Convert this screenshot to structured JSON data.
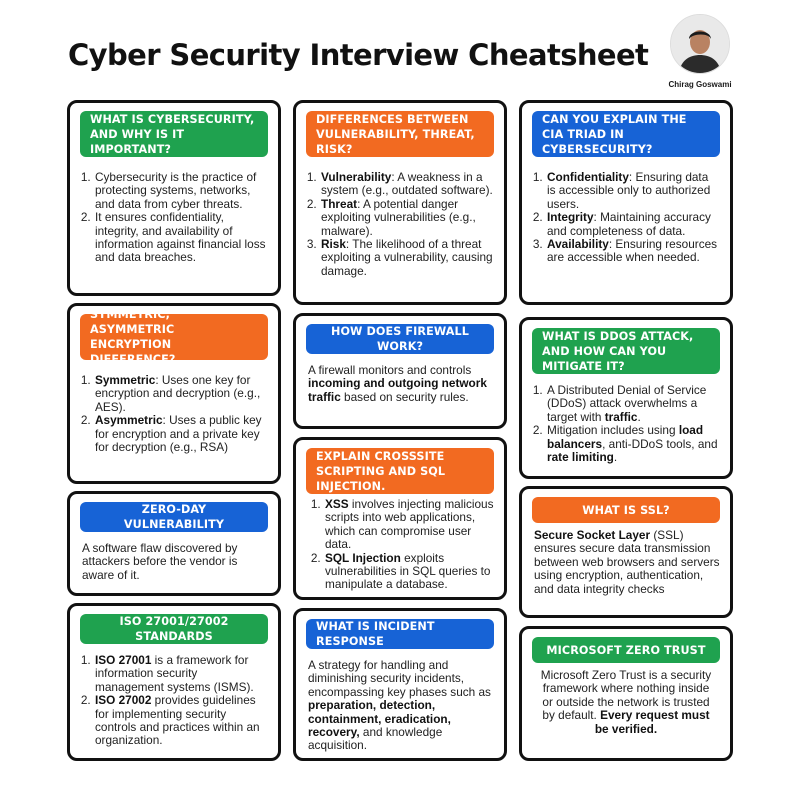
{
  "title": "Cyber Security Interview Cheatsheet",
  "author": {
    "name": "Chirag Goswami",
    "avatar_icon": "person-avatar-icon"
  },
  "colors": {
    "green": "#1fa24f",
    "orange": "#f26a21",
    "blue": "#1763d6",
    "border": "#111111"
  },
  "cards": {
    "cybersecurity": {
      "header": "WHAT IS CYBERSECURITY, AND WHY IS IT IMPORTANT?",
      "item1": "Cybersecurity is the practice of protecting systems, networks, and data from cyber threats.",
      "item2": "It ensures confidentiality, integrity, and availability of information against financial loss and data breaches."
    },
    "vuln_threat_risk": {
      "header": "DIFFERENCES BETWEEN VULNERABILITY, THREAT, RISK?",
      "item1_term": "Vulnerability",
      "item1_text": ": A weakness in a system (e.g., outdated software).",
      "item2_term": "Threat",
      "item2_text": ": A potential danger exploiting vulnerabilities (e.g., malware).",
      "item3_term": "Risk",
      "item3_text": ": The likelihood of a threat exploiting a vulnerability, causing damage."
    },
    "cia": {
      "header": "CAN YOU EXPLAIN THE CIA TRIAD IN CYBERSECURITY?",
      "item1_term": "Confidentiality",
      "item1_text": ": Ensuring data is accessible only to authorized users.",
      "item2_term": "Integrity",
      "item2_text": ": Maintaining accuracy and completeness of data.",
      "item3_term": "Availability",
      "item3_text": ": Ensuring resources are accessible when needed."
    },
    "encryption": {
      "header": "SYMMETRIC, ASYMMETRIC ENCRYPTION DIFFERENCE?",
      "item1_term": "Symmetric",
      "item1_text": ": Uses one key for encryption and decryption (e.g., AES).",
      "item2_term": "Asymmetric",
      "item2_text": ": Uses a public key for encryption and a private key for decryption (e.g., RSA)"
    },
    "firewall": {
      "header": "HOW DOES FIREWALL WORK?",
      "text_pre": "A firewall monitors and controls ",
      "text_bold": "incoming and outgoing network traffic",
      "text_post": " based on security rules."
    },
    "ddos": {
      "header": "WHAT IS DDOS ATTACK, AND HOW CAN YOU MITIGATE IT?",
      "item1_pre": "A Distributed Denial of Service (DDoS) attack overwhelms a target with ",
      "item1_bold": "traffic",
      "item1_post": ".",
      "item2_pre": " Mitigation includes using ",
      "item2_bold1": "load balancers",
      "item2_mid": ", anti-DDoS tools, and ",
      "item2_bold2": "rate limiting",
      "item2_post": "."
    },
    "xss_sql": {
      "header": "EXPLAIN CROSSSITE SCRIPTING AND SQL INJECTION.",
      "item1_term": "XSS",
      "item1_text": " involves injecting malicious scripts into web applications, which can compromise user data.",
      "item2_term": "SQL Injection",
      "item2_text": " exploits vulnerabilities in SQL queries to manipulate a database."
    },
    "zero_day": {
      "header": "ZERO-DAY VULNERABILITY",
      "text": "A software flaw discovered by attackers before the vendor is aware of it."
    },
    "ssl": {
      "header": "WHAT IS SSL?",
      "text_bold": "Secure Socket Layer",
      "text_post": " (SSL) ensures secure data transmission between web browsers and servers using encryption, authentication, and data integrity checks"
    },
    "iso": {
      "header": "ISO 27001/27002 STANDARDS",
      "item1_term": "ISO 27001",
      "item1_text": " is a framework for information security management systems (ISMS).",
      "item2_term": "ISO 27002",
      "item2_text": " provides guidelines for implementing security controls and practices within an organization."
    },
    "incident": {
      "header": "WHAT IS INCIDENT RESPONSE",
      "text_pre": "A strategy for handling and diminishing security incidents, encompassing key phases such as ",
      "text_bold": "preparation, detection, containment, eradication, recovery,",
      "text_post": " and knowledge acquisition."
    },
    "zero_trust": {
      "header": "MICROSOFT ZERO TRUST",
      "text_pre": "Microsoft Zero Trust is a security framework where nothing inside or outside the network is trusted by default. ",
      "text_bold": "Every request must be verified."
    }
  }
}
